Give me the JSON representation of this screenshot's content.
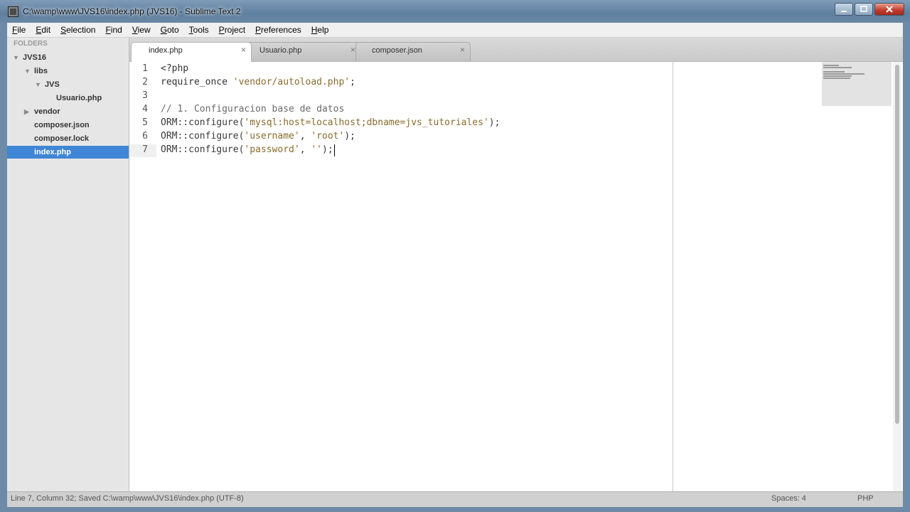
{
  "window": {
    "title": "C:\\wamp\\www\\JVS16\\index.php (JVS16) - Sublime Text 2"
  },
  "menu": [
    {
      "u": "F",
      "rest": "ile"
    },
    {
      "u": "E",
      "rest": "dit"
    },
    {
      "u": "S",
      "rest": "election"
    },
    {
      "u": "F",
      "rest": "ind"
    },
    {
      "u": "V",
      "rest": "iew"
    },
    {
      "u": "G",
      "rest": "oto"
    },
    {
      "u": "T",
      "rest": "ools"
    },
    {
      "u": "P",
      "rest": "roject"
    },
    {
      "u": "P",
      "rest": "references"
    },
    {
      "u": "H",
      "rest": "elp"
    }
  ],
  "sidebar": {
    "header": "FOLDERS",
    "tree": [
      {
        "label": "JVS16",
        "arrow": "down"
      },
      {
        "label": "libs",
        "arrow": "down"
      },
      {
        "label": "JVS",
        "arrow": "down"
      },
      {
        "label": "Usuario.php",
        "arrow": ""
      },
      {
        "label": "vendor",
        "arrow": "right"
      },
      {
        "label": "composer.json",
        "arrow": ""
      },
      {
        "label": "composer.lock",
        "arrow": ""
      },
      {
        "label": "index.php",
        "arrow": "",
        "selected": true
      }
    ]
  },
  "tabs": [
    {
      "label": "index.php",
      "active": true
    },
    {
      "label": "Usuario.php",
      "active": false
    },
    {
      "label": "composer.json",
      "active": false
    }
  ],
  "editor": {
    "line_numbers": [
      "1",
      "2",
      "3",
      "4",
      "5",
      "6",
      "7"
    ],
    "lines": [
      [
        {
          "t": "<?php",
          "c": "kw"
        }
      ],
      [
        {
          "t": "require_once ",
          "c": "kw"
        },
        {
          "t": "'vendor/autoload.php'",
          "c": "str"
        },
        {
          "t": ";",
          "c": "plain"
        }
      ],
      [],
      [
        {
          "t": "// 1. Configuracion base de datos",
          "c": "com"
        }
      ],
      [
        {
          "t": "ORM::configure(",
          "c": "plain"
        },
        {
          "t": "'mysql:host=localhost;dbname=jvs_tutoriales'",
          "c": "str"
        },
        {
          "t": ");",
          "c": "plain"
        }
      ],
      [
        {
          "t": "ORM::configure(",
          "c": "plain"
        },
        {
          "t": "'username'",
          "c": "str"
        },
        {
          "t": ", ",
          "c": "plain"
        },
        {
          "t": "'root'",
          "c": "str"
        },
        {
          "t": ");",
          "c": "plain"
        }
      ],
      [
        {
          "t": "ORM::configure(",
          "c": "plain"
        },
        {
          "t": "'password'",
          "c": "str"
        },
        {
          "t": ", ",
          "c": "plain"
        },
        {
          "t": "''",
          "c": "str"
        },
        {
          "t": ");",
          "c": "plain"
        }
      ]
    ],
    "current_line": 7
  },
  "status": {
    "left": "Line 7, Column 32; Saved C:\\wamp\\www\\JVS16\\index.php (UTF-8)",
    "spaces": "Spaces: 4",
    "syntax": "PHP"
  }
}
